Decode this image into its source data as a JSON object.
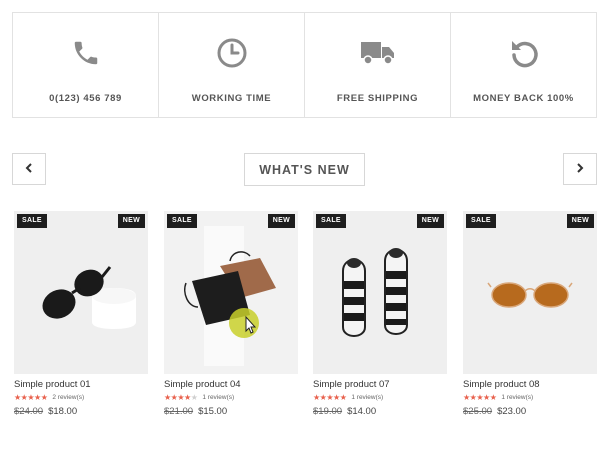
{
  "features": [
    {
      "icon": "phone-icon",
      "label": "0(123) 456 789"
    },
    {
      "icon": "clock-icon",
      "label": "WORKING TIME"
    },
    {
      "icon": "truck-icon",
      "label": "FREE SHIPPING"
    },
    {
      "icon": "refresh-icon",
      "label": "MONEY BACK 100%"
    }
  ],
  "section": {
    "title": "WHAT'S NEW"
  },
  "colors": {
    "accent": "#e8604c",
    "badge": "#1e1e1e",
    "icon": "#8a8a8a"
  },
  "products": [
    {
      "name": "Simple product 01",
      "sale_badge": "SALE",
      "new_badge": "NEW",
      "rating": 5,
      "reviews": "2 review(s)",
      "old_price": "$24.00",
      "price": "$18.00",
      "image": "sunglasses"
    },
    {
      "name": "Simple product 04",
      "sale_badge": "SALE",
      "new_badge": "NEW",
      "rating": 4,
      "reviews": "1 review(s)",
      "old_price": "$21.00",
      "price": "$15.00",
      "image": "bags"
    },
    {
      "name": "Simple product 07",
      "sale_badge": "SALE",
      "new_badge": "NEW",
      "rating": 5,
      "reviews": "1 review(s)",
      "old_price": "$19.00",
      "price": "$14.00",
      "image": "sneakers"
    },
    {
      "name": "Simple product 08",
      "sale_badge": "SALE",
      "new_badge": "NEW",
      "rating": 5,
      "reviews": "1 review(s)",
      "old_price": "$25.00",
      "price": "$23.00",
      "image": "orange-sunglasses"
    }
  ]
}
